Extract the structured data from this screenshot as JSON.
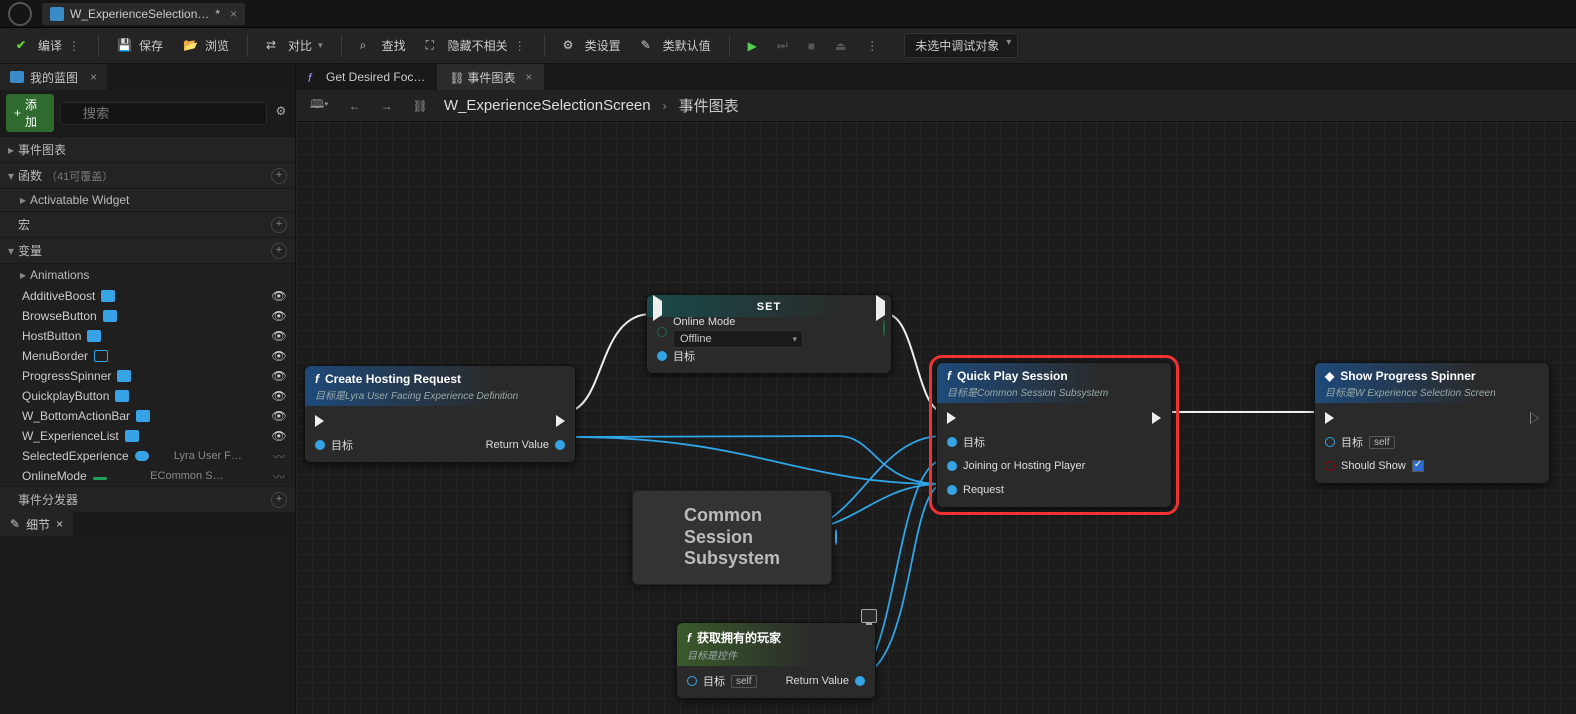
{
  "titlebar": {
    "tab_label": "W_ExperienceSelection…",
    "tab_dirty": "*"
  },
  "toolbar": {
    "compile": "编译",
    "save": "保存",
    "browse": "浏览",
    "diff": "对比",
    "find": "查找",
    "hide_unrelated": "隐藏不相关",
    "class_settings": "类设置",
    "class_defaults": "类默认值",
    "debug_target": "未选中调试对象"
  },
  "left": {
    "panel_tab": "我的蓝图",
    "add": "添加",
    "search_ph": "搜索",
    "cats": {
      "event_graph": "事件图表",
      "functions": "函数",
      "functions_sub": "（41可覆盖）",
      "activatable": "Activatable Widget",
      "macros": "宏",
      "variables": "变量",
      "animations": "Animations",
      "dispatchers": "事件分发器"
    },
    "vars": [
      {
        "name": "AdditiveBoost"
      },
      {
        "name": "BrowseButton"
      },
      {
        "name": "HostButton"
      },
      {
        "name": "MenuBorder"
      },
      {
        "name": "ProgressSpinner"
      },
      {
        "name": "QuickplayButton"
      },
      {
        "name": "W_BottomActionBar"
      },
      {
        "name": "W_ExperienceList"
      },
      {
        "name": "SelectedExperience",
        "type": "Lyra User F…"
      },
      {
        "name": "OnlineMode",
        "type": "ECommon S…"
      }
    ],
    "details_tab": "细节"
  },
  "graph_tabs": {
    "t1": "Get Desired Foc…",
    "t2": "事件图表"
  },
  "breadcrumb": {
    "root": "W_ExperienceSelectionScreen",
    "leaf": "事件图表"
  },
  "nodes": {
    "create": {
      "title": "Create Hosting Request",
      "sub": "目标是Lyra User Facing Experience Definition",
      "pin_target": "目标",
      "pin_return": "Return Value"
    },
    "set": {
      "title": "SET",
      "label_mode": "Online Mode",
      "dropdown": "Offline",
      "pin_target": "目标"
    },
    "session": {
      "big": "Common\nSession\nSubsystem"
    },
    "quick": {
      "title": "Quick Play Session",
      "sub": "目标是Common Session Subsystem",
      "pin_target": "目标",
      "pin_player": "Joining or Hosting Player",
      "pin_request": "Request"
    },
    "spinner": {
      "title": "Show Progress Spinner",
      "sub": "目标是W Experience Selection Screen",
      "pin_target": "目标",
      "self": "self",
      "pin_show": "Should Show"
    },
    "getplayer": {
      "title": "获取拥有的玩家",
      "sub": "目标是控件",
      "pin_target": "目标",
      "self": "self",
      "pin_return": "Return Value"
    }
  }
}
